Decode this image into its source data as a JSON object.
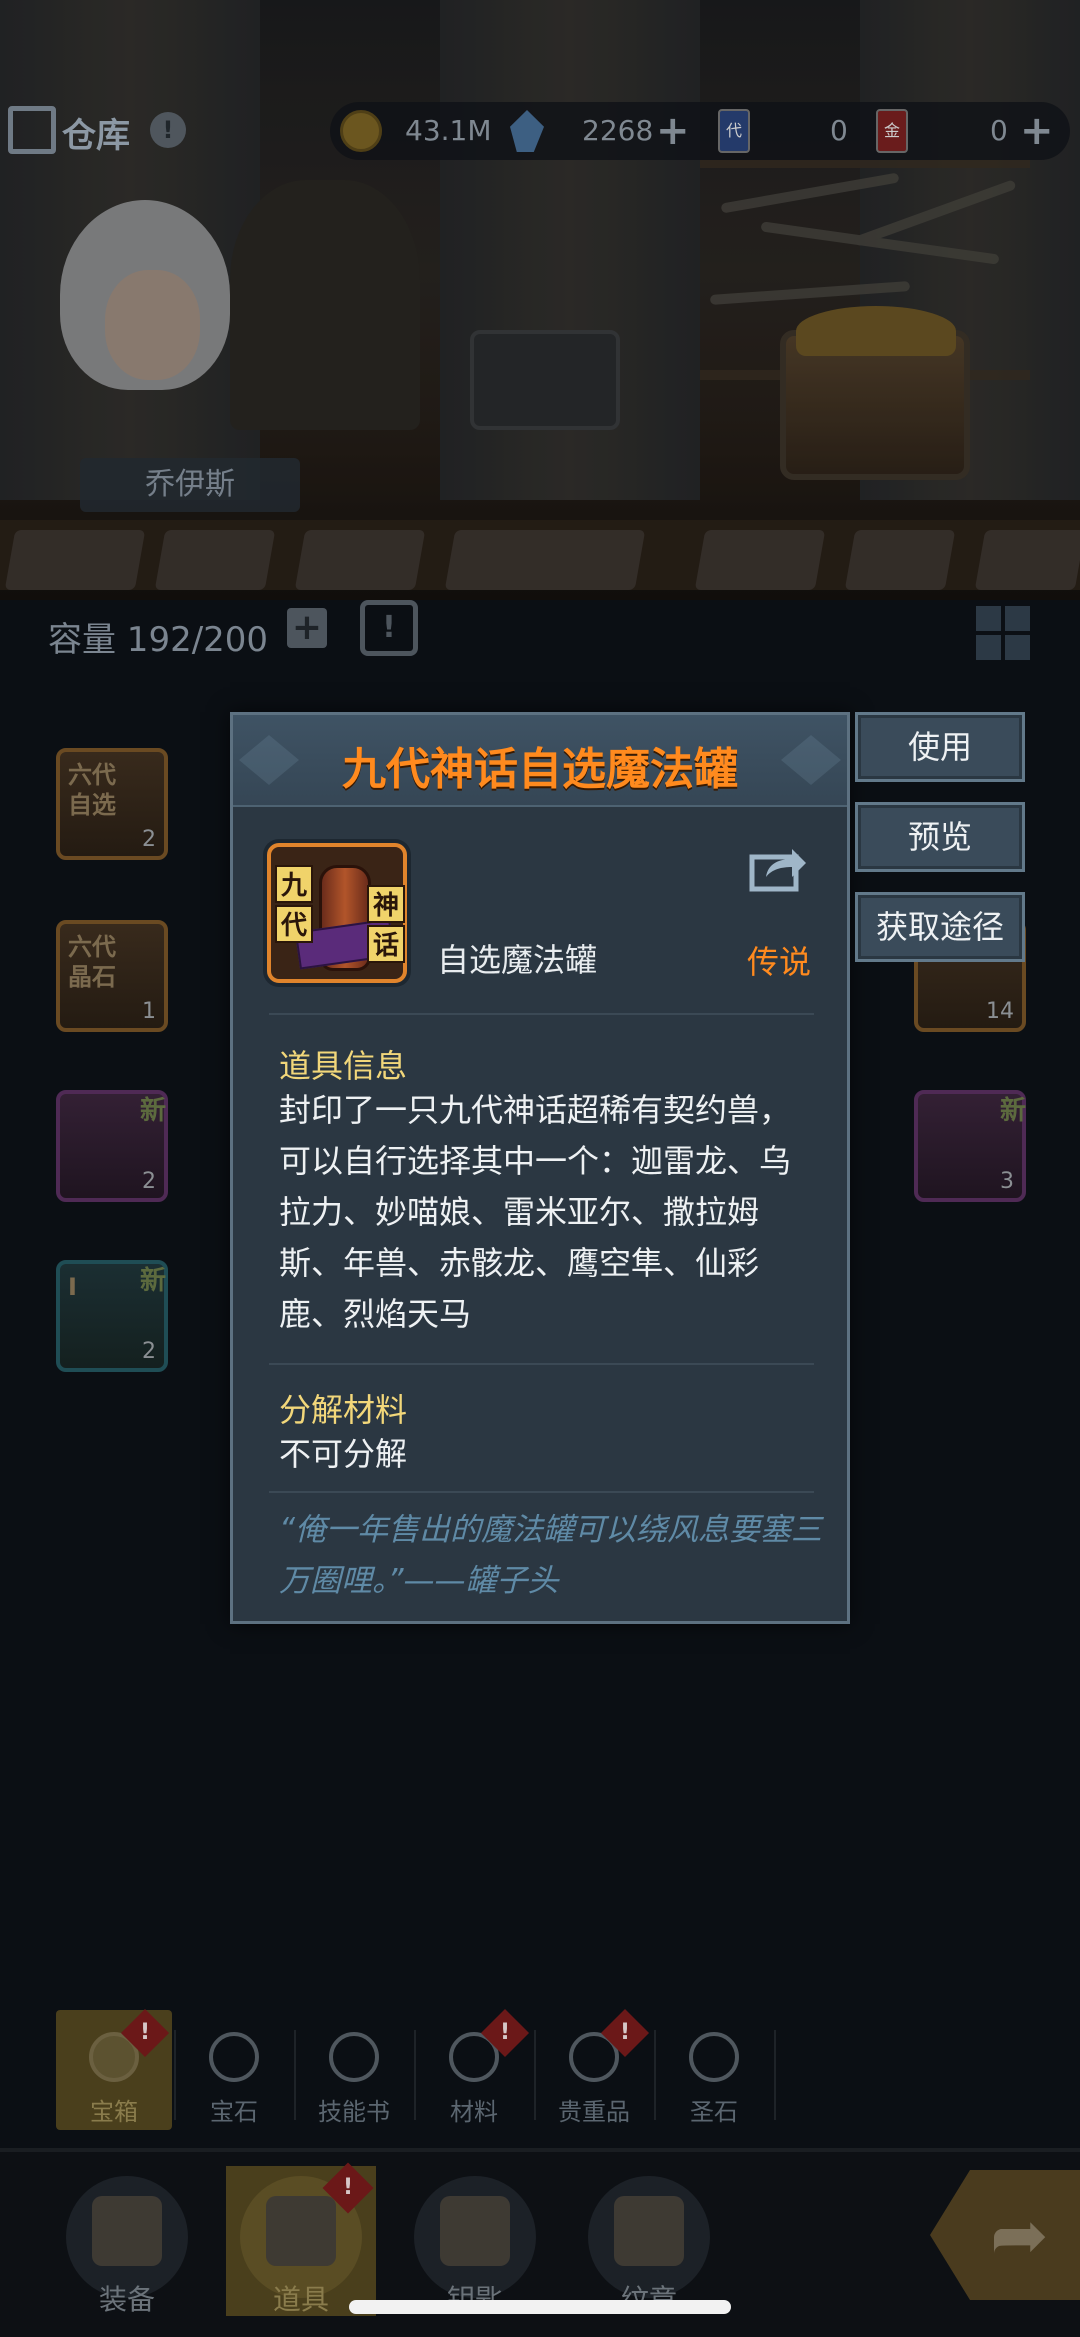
{
  "topbar": {
    "title": "仓库",
    "alert": "!",
    "gold": "43.1M",
    "gems": "2268",
    "card_blue_glyph": "代",
    "card_blue_count": "0",
    "card_red_glyph": "金",
    "card_red_count": "0"
  },
  "scene": {
    "character_name": "乔伊斯"
  },
  "capacity": {
    "label": "容量 192/200"
  },
  "inventory": {
    "slots": [
      {
        "glyph": "六代自选",
        "count": "2"
      },
      {
        "glyph": "六代晶石",
        "count": "1"
      },
      {
        "glyph": "",
        "count": "2",
        "new": "新"
      },
      {
        "glyph": "I",
        "count": "2",
        "new": "新"
      },
      {
        "glyph": "",
        "count": "14"
      },
      {
        "glyph": "",
        "count": "3",
        "new": "新"
      }
    ]
  },
  "modal": {
    "title": "九代神话自选魔法罐",
    "icon_tags": [
      "九",
      "代",
      "神",
      "话"
    ],
    "item_name": "自选魔法罐",
    "rarity": "传说",
    "info_title": "道具信息",
    "info_text": "封印了一只九代神话超稀有契约兽，可以自行选择其中一个：迦雷龙、乌拉力、妙喵娘、雷米亚尔、撒拉姆斯、年兽、赤骸龙、鹰空隼、仙彩鹿、烈焰天马",
    "decompose_title": "分解材料",
    "decompose_text": "不可分解",
    "quote": "“俺一年售出的魔法罐可以绕风息要塞三万圈哩。”——罐子头"
  },
  "actions": {
    "use": "使用",
    "preview": "预览",
    "source": "获取途径"
  },
  "categories": [
    {
      "label": "宝箱",
      "active": true,
      "badge": true
    },
    {
      "label": "宝石",
      "active": false,
      "badge": false
    },
    {
      "label": "技能书",
      "active": false,
      "badge": false
    },
    {
      "label": "材料",
      "active": false,
      "badge": true
    },
    {
      "label": "贵重品",
      "active": false,
      "badge": true
    },
    {
      "label": "圣石",
      "active": false,
      "badge": false
    }
  ],
  "nav": [
    {
      "label": "装备",
      "active": false,
      "badge": false
    },
    {
      "label": "道具",
      "active": true,
      "badge": true
    },
    {
      "label": "钥匙",
      "active": false,
      "badge": false
    },
    {
      "label": "纹章",
      "active": false,
      "badge": false
    }
  ],
  "colors": {
    "title_orange": "#ff8a1e",
    "section_yellow": "#f2d77a",
    "quote_blue": "#5f8aa6",
    "panel": "#2b3742"
  }
}
